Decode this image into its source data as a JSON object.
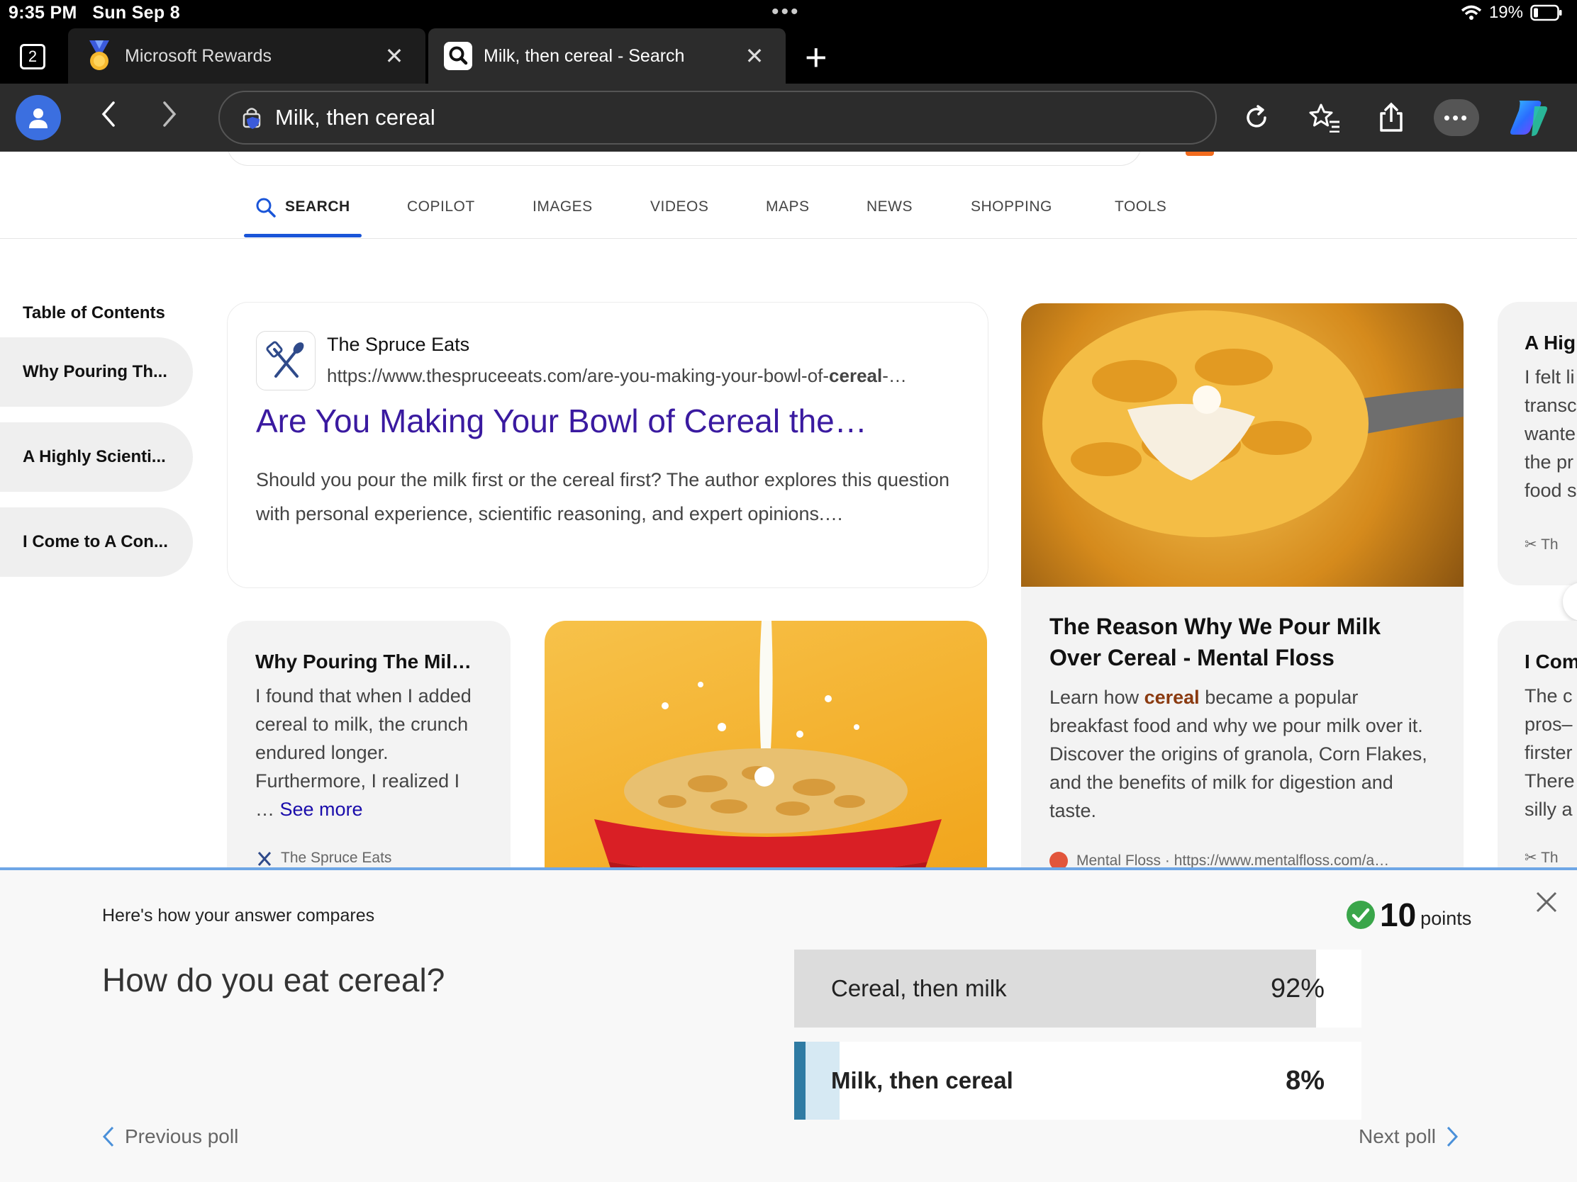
{
  "status": {
    "time": "9:35 PM",
    "date": "Sun Sep 8",
    "battery": "19%"
  },
  "tabs": {
    "count": "2",
    "items": [
      {
        "title": "Microsoft Rewards"
      },
      {
        "title": "Milk, then cereal - Search"
      }
    ]
  },
  "toolbar": {
    "url": "Milk, then cereal"
  },
  "search_nav": [
    "SEARCH",
    "COPILOT",
    "IMAGES",
    "VIDEOS",
    "MAPS",
    "NEWS",
    "SHOPPING",
    "TOOLS"
  ],
  "toc": {
    "title": "Table of Contents",
    "items": [
      "Why Pouring Th...",
      "A Highly Scienti...",
      "I Come to A Con..."
    ]
  },
  "result": {
    "site": "The Spruce Eats",
    "url_prefix": "https://www.thespruceeats.com/are-you-making-your-bowl-of-",
    "url_bold": "cereal",
    "url_suffix": "-…",
    "title": "Are You Making Your Bowl of Cereal the…",
    "snippet": "Should you pour the milk first or the cereal first? The author explores this question with personal experience, scientific reasoning, and expert opinions.…"
  },
  "card_why": {
    "title": "Why Pouring The Mil…",
    "text": "I found that when I added cereal to milk, the crunch endured longer. Furthermore, I realized I",
    "ellipsis": "…",
    "see_more": "See more",
    "source": "The Spruce Eats"
  },
  "card_reason": {
    "title": "The Reason Why We Pour Milk Over Cereal - Mental Floss",
    "text_before": "Learn how",
    "text_bold": "cereal",
    "text_after": "became a popular breakfast food and why we pour milk over it. Discover the origins of granola, Corn Flakes, and the benefits of milk for digestion and taste.",
    "source": "Mental Floss · https://www.mentalfloss.com/a…"
  },
  "card_right1": {
    "title": "A Hig",
    "lines": [
      "I felt li",
      "transc",
      "wante",
      "the pr",
      "food s"
    ],
    "source": "Th"
  },
  "card_right2": {
    "title": "I Com",
    "lines": [
      "The c",
      "pros–",
      "firster",
      "There",
      "silly a"
    ],
    "source": "Th"
  },
  "poll": {
    "compare_label": "Here's how your answer compares",
    "points_value": "10",
    "points_label": "points",
    "question": "How do you eat cereal?",
    "options": [
      {
        "label": "Cereal, then milk",
        "percent": "92%",
        "fraction": 0.92,
        "selected": false
      },
      {
        "label": "Milk, then cereal",
        "percent": "8%",
        "fraction": 0.08,
        "selected": true
      }
    ],
    "previous": "Previous poll",
    "next": "Next poll"
  },
  "colors": {
    "accent": "#1a55d8",
    "link": "#3a1aa0",
    "poll_selected": "#2f7ba3",
    "check": "#3aa64a"
  }
}
